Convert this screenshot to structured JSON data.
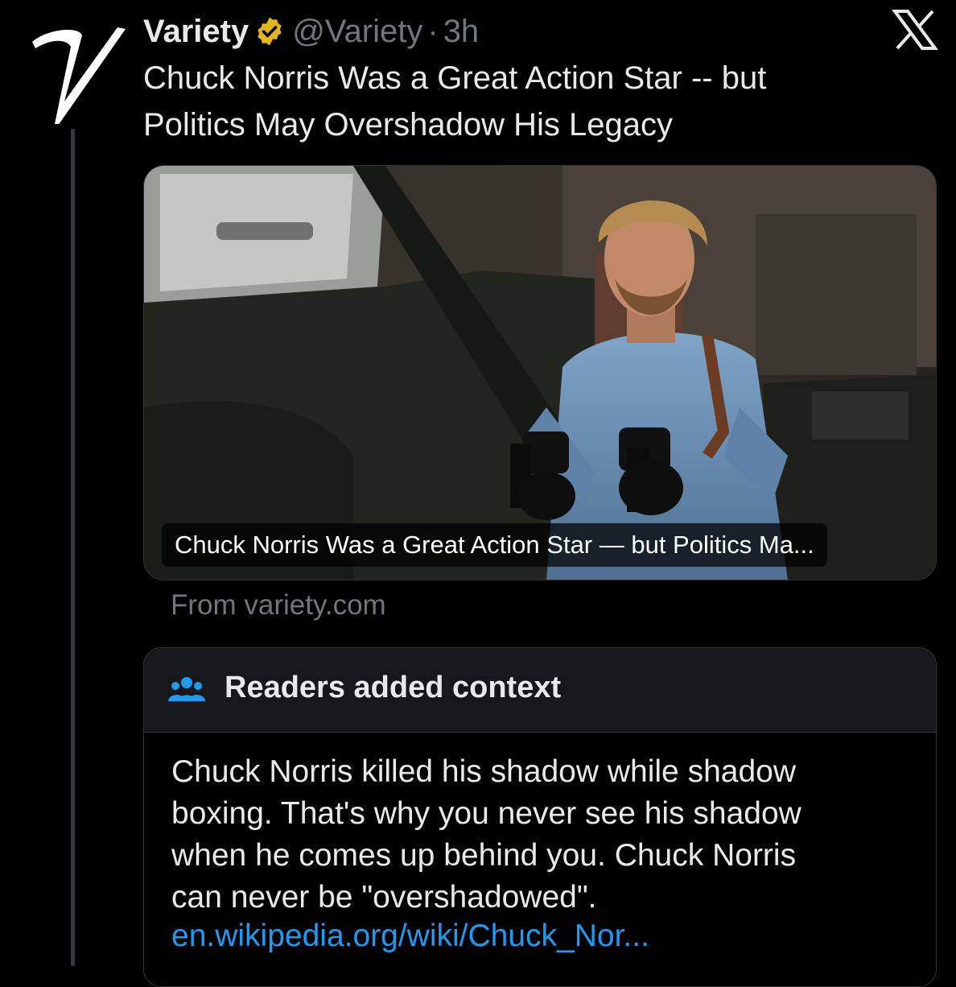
{
  "tweet": {
    "display_name": "Variety",
    "handle": "@Variety",
    "separator": "·",
    "time": "3h",
    "avatar_icon": "variety-v-logo-icon",
    "verified_icon": "gold-verified-badge-icon",
    "text_line1": "Chuck Norris Was a Great Action Star -- but",
    "text_line2": "Politics May Overshadow His Legacy"
  },
  "platform": {
    "logo_icon": "x-logo-icon"
  },
  "card": {
    "image_description_icon": "movie-still-photo",
    "caption": "Chuck Norris Was a Great Action Star — but Politics Ma...",
    "source": "From variety.com"
  },
  "community_note": {
    "icon": "people-group-icon",
    "title": "Readers added context",
    "body_line1": "Chuck Norris killed his shadow while shadow",
    "body_line2": "boxing. That's why you never see his shadow",
    "body_line3": "when he comes up behind you. Chuck Norris",
    "body_line4": "can never be \"overshadowed\".",
    "link": "en.wikipedia.org/wiki/Chuck_Nor..."
  },
  "colors": {
    "background": "#000000",
    "primary_text": "#e7e9ea",
    "secondary_text": "#71767b",
    "link": "#1d9bf0",
    "verified_gold": "#e2b719",
    "note_icon": "#1d9bf0"
  }
}
